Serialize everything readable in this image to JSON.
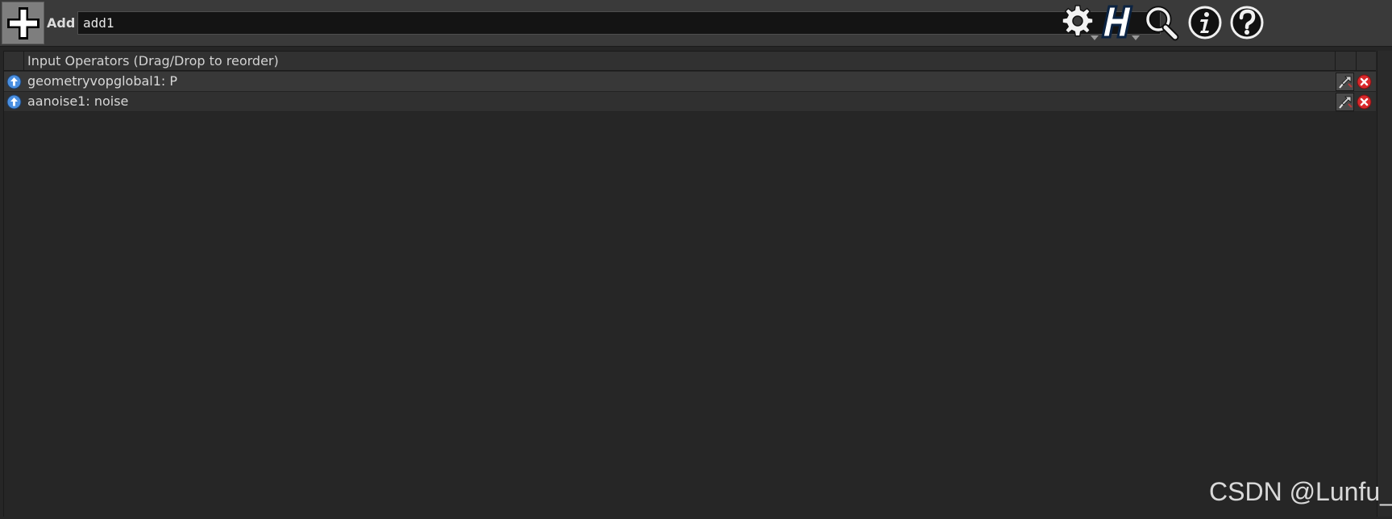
{
  "header": {
    "node_icon": "plus-cross-icon",
    "node_type_label": "Add",
    "node_name_value": "add1",
    "tools": [
      {
        "name": "gear-icon"
      },
      {
        "name": "houdini-help-h-icon"
      },
      {
        "name": "magnifier-icon"
      },
      {
        "name": "info-icon"
      },
      {
        "name": "question-icon"
      }
    ]
  },
  "list": {
    "header_title": "Input Operators (Drag/Drop to reorder)",
    "rows": [
      {
        "label": "geometryvopglobal1: P"
      },
      {
        "label": "aanoise1: noise"
      }
    ]
  },
  "colors": {
    "background": "#262626",
    "header": "#3a3a3a",
    "up_button": "#4a8fe0",
    "delete_button": "#d9282b"
  },
  "watermark": "CSDN @Lunfu_"
}
